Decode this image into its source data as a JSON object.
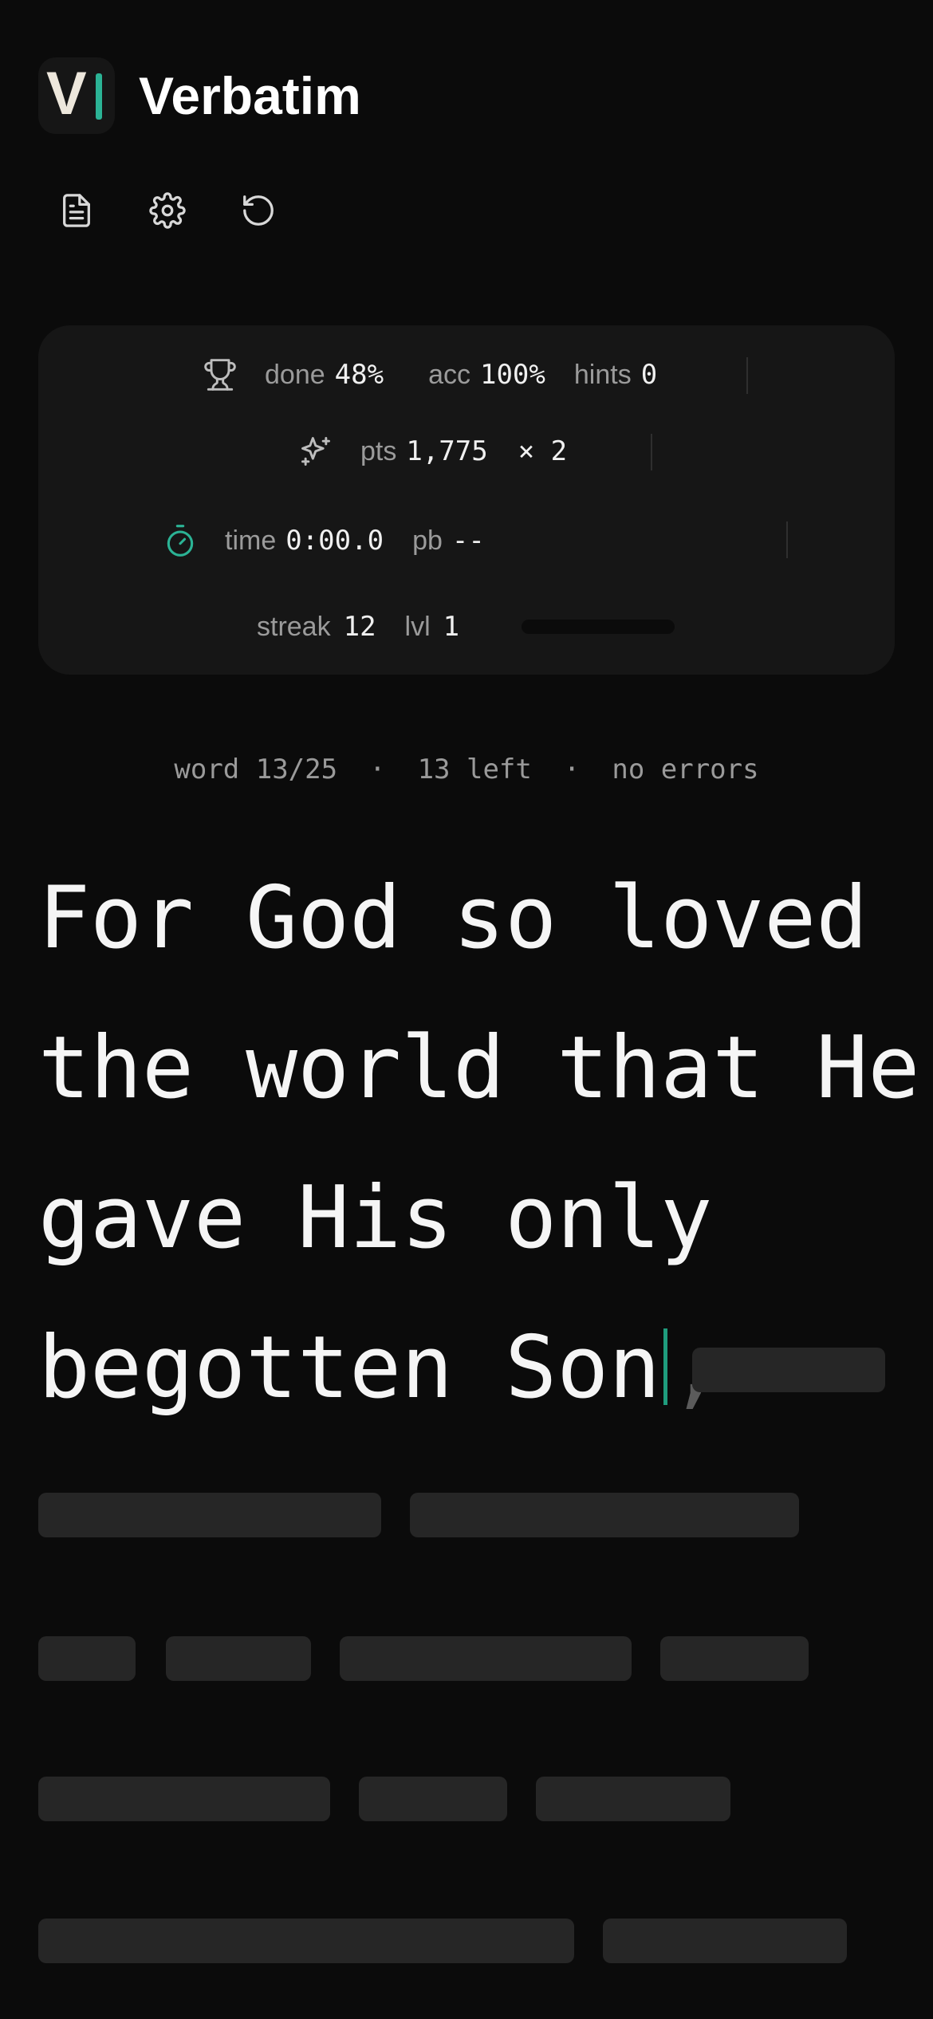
{
  "header": {
    "logo_letter": "V",
    "title": "Verbatim"
  },
  "toolbar": {
    "icons": [
      "document-icon",
      "settings-icon",
      "restart-icon"
    ]
  },
  "stats": {
    "done_label": "done",
    "done_value": "48%",
    "acc_label": "acc",
    "acc_value": "100%",
    "hints_label": "hints",
    "hints_value": "0",
    "pts_label": "pts",
    "pts_value": "1,775",
    "multiplier": "× 2",
    "time_label": "time",
    "time_value": "0:00.0",
    "pb_label": "pb",
    "pb_value": "--",
    "streak_label": "streak",
    "streak_value": "12",
    "lvl_label": "lvl",
    "lvl_value": "1",
    "level_progress": 0
  },
  "status": {
    "word_progress": "word 13/25",
    "left": "13 left",
    "errors": "no errors",
    "separator": "·"
  },
  "verse": {
    "line1": "For God so loved",
    "line2": "the world that He",
    "line3": "gave His only",
    "line4_typed": "begotten Son",
    "next_punct": ","
  },
  "colors": {
    "accent": "#2bb395",
    "caret": "#1f9c7d",
    "background": "#0b0b0b",
    "card": "#161616",
    "placeholder": "#262626"
  }
}
